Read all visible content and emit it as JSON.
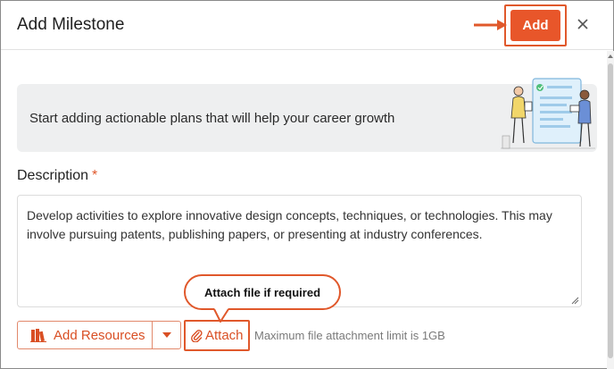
{
  "dialog": {
    "title": "Add Milestone",
    "add_label": "Add",
    "close_icon": "close-icon"
  },
  "banner": {
    "text": "Start adding actionable plans that will help your career growth",
    "illustration": "career-plan-illustration"
  },
  "description": {
    "label": "Description",
    "required_mark": "*",
    "value": "Develop activities to explore innovative design concepts, techniques, or technologies. This may involve pursuing patents, publishing papers, or presenting at industry conferences."
  },
  "callout": {
    "text": "Attach file if required"
  },
  "footer": {
    "add_resources_label": "Add Resources",
    "add_resources_icon": "books-icon",
    "dropdown_icon": "caret-down-icon",
    "attach_label": "Attach",
    "attach_icon": "paperclip-icon",
    "limit_text": "Maximum file attachment limit is 1GB"
  },
  "colors": {
    "accent": "#e8562a",
    "highlight_border": "#e0582b",
    "banner_bg": "#eeeff0"
  }
}
